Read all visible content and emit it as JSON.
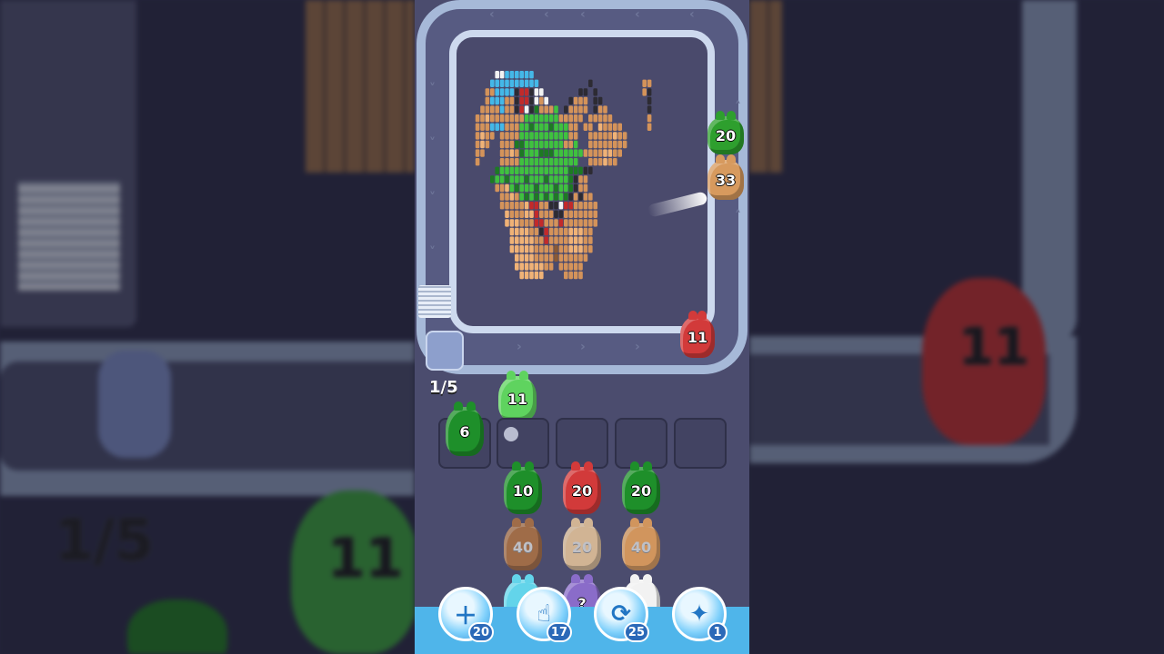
{
  "game": {
    "progress_label": "1/5",
    "conveyor_pieces": [
      {
        "value": "20",
        "color": "#2e9f2e"
      },
      {
        "value": "33",
        "color": "#d79a5e"
      },
      {
        "value": "11",
        "color": "#d23a3a"
      }
    ],
    "held_piece": {
      "value": "11",
      "color": "#5fd35f"
    },
    "slot_piece": {
      "value": "6",
      "color": "#1e8f2a"
    },
    "queue": [
      [
        {
          "value": "10",
          "color": "#1e8f2a"
        },
        {
          "value": "20",
          "color": "#d23a3a"
        },
        {
          "value": "20",
          "color": "#1e8f2a"
        }
      ],
      [
        {
          "value": "40",
          "color": "#b5743f"
        },
        {
          "value": "20",
          "color": "#f3cf9e"
        },
        {
          "value": "40",
          "color": "#f3a85a"
        }
      ],
      [
        {
          "value": "",
          "color": "#63d4ea"
        },
        {
          "value": "?",
          "color": "#8a6cc9"
        },
        {
          "value": "",
          "color": "#f2f2f2"
        }
      ]
    ],
    "boosters": [
      {
        "icon": "add-slot-icon",
        "glyph": "＋",
        "count": "20"
      },
      {
        "icon": "hand-pick-icon",
        "glyph": "☝",
        "count": "17"
      },
      {
        "icon": "shuffle-icon",
        "glyph": "⟳",
        "count": "25"
      },
      {
        "icon": "magnet-blob-icon",
        "glyph": "✦",
        "count": "1"
      }
    ]
  },
  "background": {
    "progress_label": "1/5",
    "blob_left": "11",
    "blob_right": "11"
  }
}
